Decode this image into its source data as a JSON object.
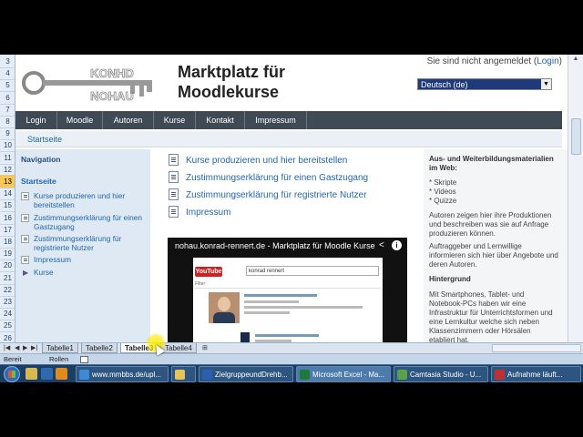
{
  "row_numbers": [
    "3",
    "4",
    "5",
    "6",
    "7",
    "8",
    "9",
    "10",
    "11",
    "12",
    "13",
    "14",
    "15",
    "16",
    "17",
    "18",
    "19",
    "20",
    "21",
    "22",
    "23",
    "24",
    "25",
    "26"
  ],
  "selected_row": "13",
  "header": {
    "logo_text_top": "KONHD",
    "logo_text_bottom": "NOHAU",
    "site_title": "Marktplatz für Moodlekurse",
    "login_text": "Sie sind nicht angemeldet (",
    "login_link": "Login",
    "login_close": ")",
    "language": "Deutsch (de)"
  },
  "navbar": [
    "Login",
    "Moodle",
    "Autoren",
    "Kurse",
    "Kontakt",
    "Impressum"
  ],
  "breadcrumb": "Startseite",
  "leftnav": {
    "heading": "Navigation",
    "start": "Startseite",
    "items": [
      "Kurse produzieren und hier bereitstellen",
      "Zustimmungserklärung für einen Gastzugang",
      "Zustimmungserklärung für registrierte Nutzer",
      "Impressum",
      "Kurse"
    ]
  },
  "center_links": [
    "Kurse produzieren und hier bereitstellen",
    "Zustimmungserklärung für einen Gastzugang",
    "Zustimmungserklärung für registrierte Nutzer",
    "Impressum"
  ],
  "video": {
    "title": "nohau.konrad-rennert.de - Marktplatz für Moodle Kurse",
    "yt_logo": "YouTube",
    "search_text": "konrad rennert",
    "filter_label": "Filter"
  },
  "rightcol": {
    "heading": "Aus- und Weiterbildungsmaterialien im Web:",
    "bullets": [
      "* Skripte",
      "* Videos",
      "* Quizze"
    ],
    "para1": "Autoren zeigen hier ihre Produktionen und beschreiben was sie auf Anfrage produzieren können.",
    "para2": "Auftraggeber und Lernwillige informieren sich hier über Angebote und deren Autoren.",
    "heading2": "Hintergrund",
    "para3": "Mit Smartphones, Tablet- und Notebook-PCs haben wir eine Infrastruktur für Unterrichtsformen und eine Lernkultur welche sich neben Klassenzimmern oder Hörsälen etabliert hat."
  },
  "sheet_tabs": [
    "Tabelle1",
    "Tabelle2",
    "Tabelle3",
    "Tabelle4"
  ],
  "active_sheet": "Tabelle3",
  "status": {
    "ready": "Bereit",
    "scroll": "Rollen"
  },
  "taskbar": {
    "items": [
      {
        "label": "www.mmbbs.de/upl...",
        "color": "#3b8ad6"
      },
      {
        "label": "",
        "color": "#e8c35a"
      },
      {
        "label": "ZielgruppeundDrehb...",
        "color": "#2b5fb4"
      },
      {
        "label": "Microsoft Excel - Ma...",
        "color": "#1f7a3a"
      },
      {
        "label": "Camtasia Studio - U...",
        "color": "#5aa04a"
      },
      {
        "label": "Aufnahme läuft...",
        "color": "#c03030"
      }
    ]
  }
}
